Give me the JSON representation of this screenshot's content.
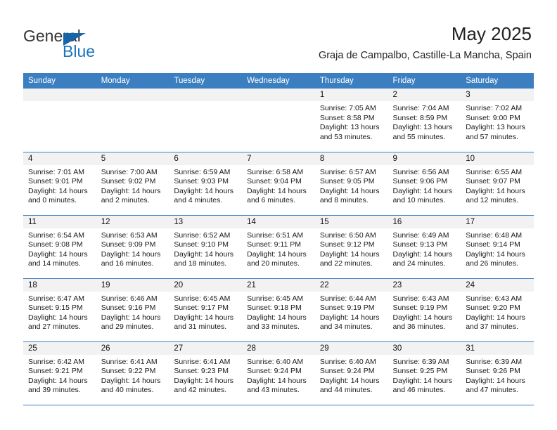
{
  "brand": {
    "name_part1": "General",
    "name_part2": "Blue",
    "logo_icon": "blue-triangle-logo",
    "accent_color": "#1b74bb"
  },
  "header": {
    "title": "May 2025",
    "subtitle": "Graja de Campalbo, Castille-La Mancha, Spain"
  },
  "theme": {
    "header_blue": "#3c7fc1",
    "daynum_gray": "#f2f2f2"
  },
  "weekdays": [
    "Sunday",
    "Monday",
    "Tuesday",
    "Wednesday",
    "Thursday",
    "Friday",
    "Saturday"
  ],
  "weeks": [
    [
      {
        "day": "",
        "sunrise": "",
        "sunset": "",
        "daylight": "",
        "daylight2": ""
      },
      {
        "day": "",
        "sunrise": "",
        "sunset": "",
        "daylight": "",
        "daylight2": ""
      },
      {
        "day": "",
        "sunrise": "",
        "sunset": "",
        "daylight": "",
        "daylight2": ""
      },
      {
        "day": "",
        "sunrise": "",
        "sunset": "",
        "daylight": "",
        "daylight2": ""
      },
      {
        "day": "1",
        "sunrise": "Sunrise: 7:05 AM",
        "sunset": "Sunset: 8:58 PM",
        "daylight": "Daylight: 13 hours",
        "daylight2": "and 53 minutes."
      },
      {
        "day": "2",
        "sunrise": "Sunrise: 7:04 AM",
        "sunset": "Sunset: 8:59 PM",
        "daylight": "Daylight: 13 hours",
        "daylight2": "and 55 minutes."
      },
      {
        "day": "3",
        "sunrise": "Sunrise: 7:02 AM",
        "sunset": "Sunset: 9:00 PM",
        "daylight": "Daylight: 13 hours",
        "daylight2": "and 57 minutes."
      }
    ],
    [
      {
        "day": "4",
        "sunrise": "Sunrise: 7:01 AM",
        "sunset": "Sunset: 9:01 PM",
        "daylight": "Daylight: 14 hours",
        "daylight2": "and 0 minutes."
      },
      {
        "day": "5",
        "sunrise": "Sunrise: 7:00 AM",
        "sunset": "Sunset: 9:02 PM",
        "daylight": "Daylight: 14 hours",
        "daylight2": "and 2 minutes."
      },
      {
        "day": "6",
        "sunrise": "Sunrise: 6:59 AM",
        "sunset": "Sunset: 9:03 PM",
        "daylight": "Daylight: 14 hours",
        "daylight2": "and 4 minutes."
      },
      {
        "day": "7",
        "sunrise": "Sunrise: 6:58 AM",
        "sunset": "Sunset: 9:04 PM",
        "daylight": "Daylight: 14 hours",
        "daylight2": "and 6 minutes."
      },
      {
        "day": "8",
        "sunrise": "Sunrise: 6:57 AM",
        "sunset": "Sunset: 9:05 PM",
        "daylight": "Daylight: 14 hours",
        "daylight2": "and 8 minutes."
      },
      {
        "day": "9",
        "sunrise": "Sunrise: 6:56 AM",
        "sunset": "Sunset: 9:06 PM",
        "daylight": "Daylight: 14 hours",
        "daylight2": "and 10 minutes."
      },
      {
        "day": "10",
        "sunrise": "Sunrise: 6:55 AM",
        "sunset": "Sunset: 9:07 PM",
        "daylight": "Daylight: 14 hours",
        "daylight2": "and 12 minutes."
      }
    ],
    [
      {
        "day": "11",
        "sunrise": "Sunrise: 6:54 AM",
        "sunset": "Sunset: 9:08 PM",
        "daylight": "Daylight: 14 hours",
        "daylight2": "and 14 minutes."
      },
      {
        "day": "12",
        "sunrise": "Sunrise: 6:53 AM",
        "sunset": "Sunset: 9:09 PM",
        "daylight": "Daylight: 14 hours",
        "daylight2": "and 16 minutes."
      },
      {
        "day": "13",
        "sunrise": "Sunrise: 6:52 AM",
        "sunset": "Sunset: 9:10 PM",
        "daylight": "Daylight: 14 hours",
        "daylight2": "and 18 minutes."
      },
      {
        "day": "14",
        "sunrise": "Sunrise: 6:51 AM",
        "sunset": "Sunset: 9:11 PM",
        "daylight": "Daylight: 14 hours",
        "daylight2": "and 20 minutes."
      },
      {
        "day": "15",
        "sunrise": "Sunrise: 6:50 AM",
        "sunset": "Sunset: 9:12 PM",
        "daylight": "Daylight: 14 hours",
        "daylight2": "and 22 minutes."
      },
      {
        "day": "16",
        "sunrise": "Sunrise: 6:49 AM",
        "sunset": "Sunset: 9:13 PM",
        "daylight": "Daylight: 14 hours",
        "daylight2": "and 24 minutes."
      },
      {
        "day": "17",
        "sunrise": "Sunrise: 6:48 AM",
        "sunset": "Sunset: 9:14 PM",
        "daylight": "Daylight: 14 hours",
        "daylight2": "and 26 minutes."
      }
    ],
    [
      {
        "day": "18",
        "sunrise": "Sunrise: 6:47 AM",
        "sunset": "Sunset: 9:15 PM",
        "daylight": "Daylight: 14 hours",
        "daylight2": "and 27 minutes."
      },
      {
        "day": "19",
        "sunrise": "Sunrise: 6:46 AM",
        "sunset": "Sunset: 9:16 PM",
        "daylight": "Daylight: 14 hours",
        "daylight2": "and 29 minutes."
      },
      {
        "day": "20",
        "sunrise": "Sunrise: 6:45 AM",
        "sunset": "Sunset: 9:17 PM",
        "daylight": "Daylight: 14 hours",
        "daylight2": "and 31 minutes."
      },
      {
        "day": "21",
        "sunrise": "Sunrise: 6:45 AM",
        "sunset": "Sunset: 9:18 PM",
        "daylight": "Daylight: 14 hours",
        "daylight2": "and 33 minutes."
      },
      {
        "day": "22",
        "sunrise": "Sunrise: 6:44 AM",
        "sunset": "Sunset: 9:19 PM",
        "daylight": "Daylight: 14 hours",
        "daylight2": "and 34 minutes."
      },
      {
        "day": "23",
        "sunrise": "Sunrise: 6:43 AM",
        "sunset": "Sunset: 9:19 PM",
        "daylight": "Daylight: 14 hours",
        "daylight2": "and 36 minutes."
      },
      {
        "day": "24",
        "sunrise": "Sunrise: 6:43 AM",
        "sunset": "Sunset: 9:20 PM",
        "daylight": "Daylight: 14 hours",
        "daylight2": "and 37 minutes."
      }
    ],
    [
      {
        "day": "25",
        "sunrise": "Sunrise: 6:42 AM",
        "sunset": "Sunset: 9:21 PM",
        "daylight": "Daylight: 14 hours",
        "daylight2": "and 39 minutes."
      },
      {
        "day": "26",
        "sunrise": "Sunrise: 6:41 AM",
        "sunset": "Sunset: 9:22 PM",
        "daylight": "Daylight: 14 hours",
        "daylight2": "and 40 minutes."
      },
      {
        "day": "27",
        "sunrise": "Sunrise: 6:41 AM",
        "sunset": "Sunset: 9:23 PM",
        "daylight": "Daylight: 14 hours",
        "daylight2": "and 42 minutes."
      },
      {
        "day": "28",
        "sunrise": "Sunrise: 6:40 AM",
        "sunset": "Sunset: 9:24 PM",
        "daylight": "Daylight: 14 hours",
        "daylight2": "and 43 minutes."
      },
      {
        "day": "29",
        "sunrise": "Sunrise: 6:40 AM",
        "sunset": "Sunset: 9:24 PM",
        "daylight": "Daylight: 14 hours",
        "daylight2": "and 44 minutes."
      },
      {
        "day": "30",
        "sunrise": "Sunrise: 6:39 AM",
        "sunset": "Sunset: 9:25 PM",
        "daylight": "Daylight: 14 hours",
        "daylight2": "and 46 minutes."
      },
      {
        "day": "31",
        "sunrise": "Sunrise: 6:39 AM",
        "sunset": "Sunset: 9:26 PM",
        "daylight": "Daylight: 14 hours",
        "daylight2": "and 47 minutes."
      }
    ]
  ]
}
